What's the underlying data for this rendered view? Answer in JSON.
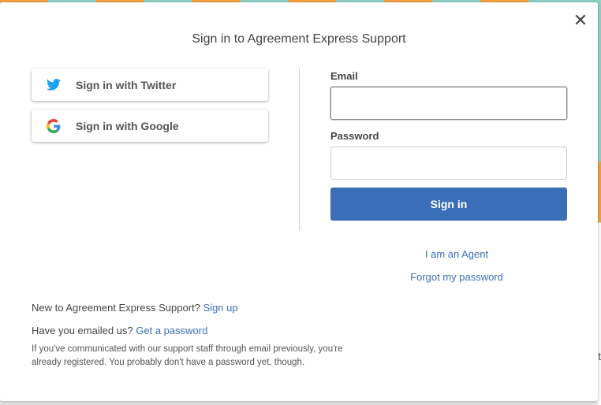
{
  "dialog": {
    "title": "Sign in to Agreement Express Support",
    "close_symbol": "✕"
  },
  "sso": {
    "twitter_label": "Sign in with Twitter",
    "google_label": "Sign in with Google"
  },
  "form": {
    "email_label": "Email",
    "email_value": "",
    "password_label": "Password",
    "password_value": "",
    "submit_label": "Sign in"
  },
  "links": {
    "agent": "I am an Agent",
    "forgot": "Forgot my password"
  },
  "footer": {
    "signup_prompt": "New to Agreement Express Support?",
    "signup_link": "Sign up",
    "emailed_prompt": "Have you emailed us?",
    "get_password_link": "Get a password",
    "note": "If you've communicated with our support staff through email previously, you're already registered. You probably don't have a password yet, though."
  },
  "background": {
    "peek_text": "t"
  },
  "colors": {
    "accent": "#3a6fb7",
    "twitter_blue": "#1da1f2"
  }
}
